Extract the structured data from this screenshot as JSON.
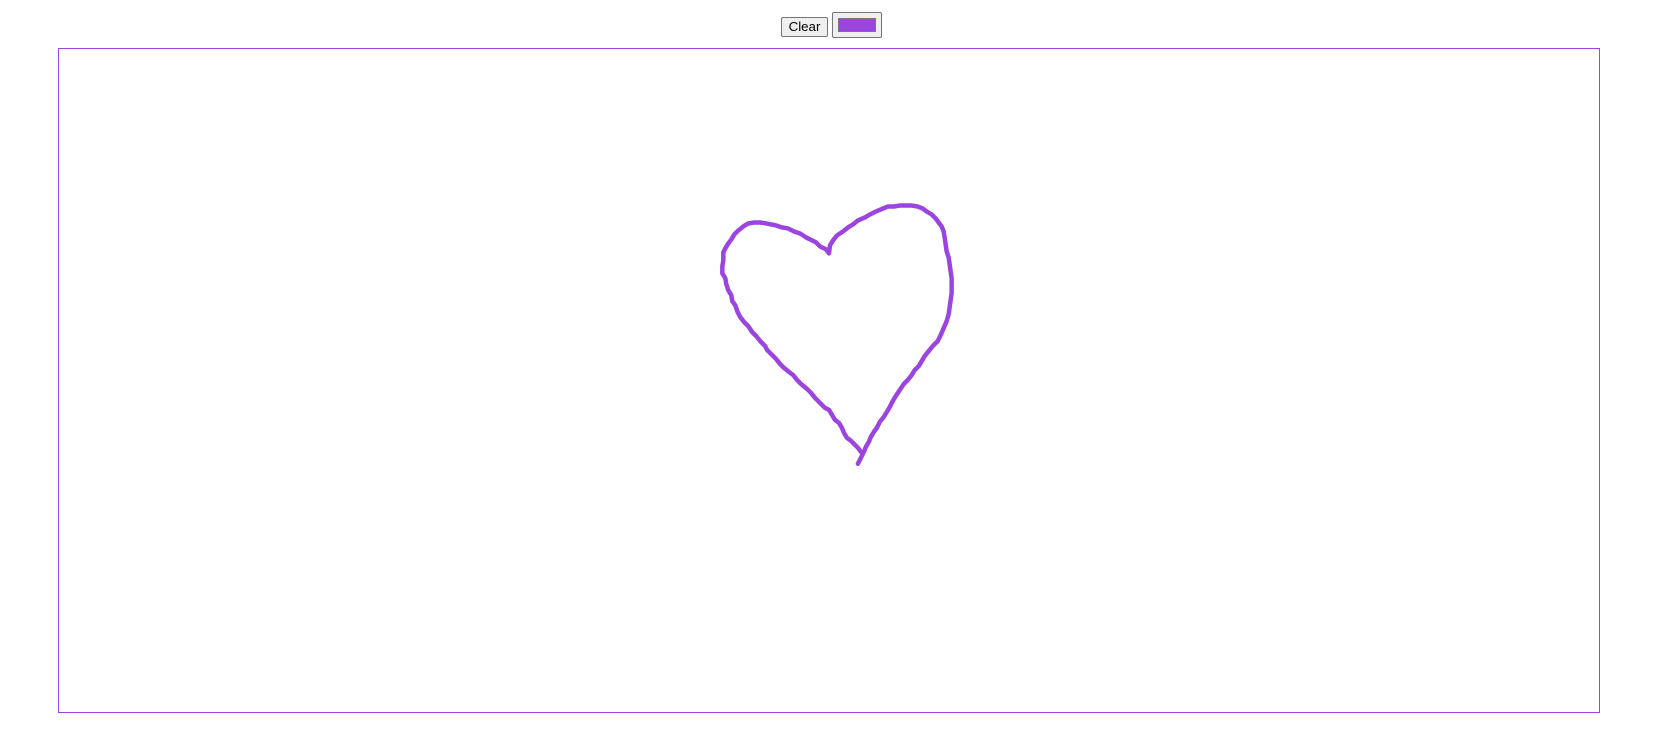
{
  "toolbar": {
    "clear_label": "Clear",
    "color_value": "#9b44e0"
  },
  "canvas": {
    "border_color": "#9b44e0",
    "stroke_color": "#9b44e0",
    "drawing_subject": "heart-stroke"
  }
}
